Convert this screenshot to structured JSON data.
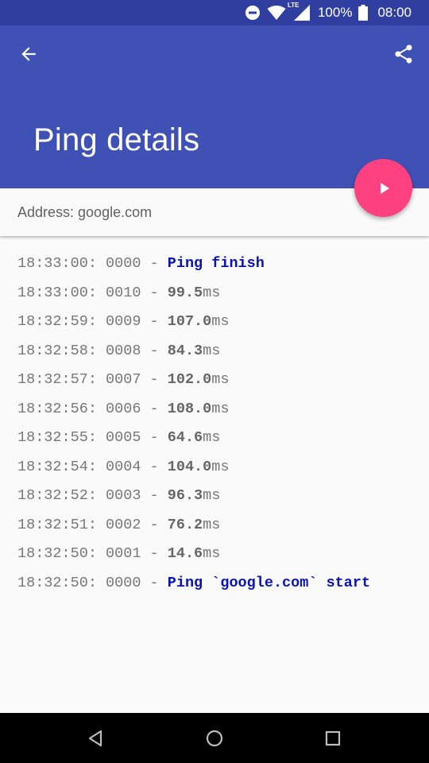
{
  "status_bar": {
    "battery_text": "100%",
    "time": "08:00",
    "icons": [
      "do-not-disturb-icon",
      "wifi-icon",
      "lte-signal-icon",
      "battery-icon"
    ],
    "network_label": "LTE"
  },
  "app_bar": {
    "title": "Ping details",
    "back_icon": "arrow-back-icon",
    "share_icon": "share-icon",
    "color": "#3f51b5",
    "status_color": "#303f9f"
  },
  "address": {
    "text": "Address: google.com"
  },
  "fab": {
    "icon": "play-icon",
    "color": "#ff4081"
  },
  "log": [
    {
      "prefix": "18:33:00: 0000 - ",
      "message": "Ping finish"
    },
    {
      "prefix": "18:33:00: 0010 - ",
      "value": "99.5",
      "unit": "ms"
    },
    {
      "prefix": "18:32:59: 0009 - ",
      "value": "107.0",
      "unit": "ms"
    },
    {
      "prefix": "18:32:58: 0008 - ",
      "value": "84.3",
      "unit": "ms"
    },
    {
      "prefix": "18:32:57: 0007 - ",
      "value": "102.0",
      "unit": "ms"
    },
    {
      "prefix": "18:32:56: 0006 - ",
      "value": "108.0",
      "unit": "ms"
    },
    {
      "prefix": "18:32:55: 0005 - ",
      "value": "64.6",
      "unit": "ms"
    },
    {
      "prefix": "18:32:54: 0004 - ",
      "value": "104.0",
      "unit": "ms"
    },
    {
      "prefix": "18:32:52: 0003 - ",
      "value": "96.3",
      "unit": "ms"
    },
    {
      "prefix": "18:32:51: 0002 - ",
      "value": "76.2",
      "unit": "ms"
    },
    {
      "prefix": "18:32:50: 0001 - ",
      "value": "14.6",
      "unit": "ms"
    },
    {
      "prefix": "18:32:50: 0000 - ",
      "message": "Ping `google.com` start"
    }
  ],
  "nav_bar": {
    "icons": [
      "back-triangle-icon",
      "home-circle-icon",
      "recents-square-icon"
    ]
  }
}
